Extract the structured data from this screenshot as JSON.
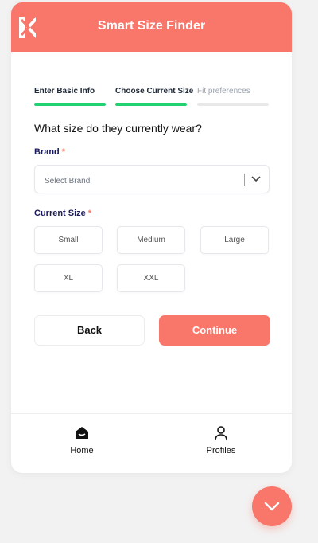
{
  "header": {
    "title": "Smart Size Finder",
    "logo": "k-logo"
  },
  "steps": [
    {
      "label": "Enter Basic Info",
      "state": "complete"
    },
    {
      "label": "Choose Current Size",
      "state": "active"
    },
    {
      "label": "Fit preferences",
      "state": "pending"
    }
  ],
  "form": {
    "question": "What size do they currently wear?",
    "brand": {
      "label": "Brand",
      "required_mark": "*",
      "placeholder": "Select Brand"
    },
    "current_size": {
      "label": "Current Size",
      "required_mark": "*",
      "options": [
        "Small",
        "Medium",
        "Large",
        "XL",
        "XXL"
      ]
    }
  },
  "actions": {
    "back_label": "Back",
    "continue_label": "Continue"
  },
  "bottom_nav": [
    {
      "label": "Home",
      "icon": "home-icon"
    },
    {
      "label": "Profiles",
      "icon": "person-icon"
    }
  ],
  "colors": {
    "accent": "#f8776a",
    "progress": "#22d172",
    "label": "#1b1b5c"
  }
}
